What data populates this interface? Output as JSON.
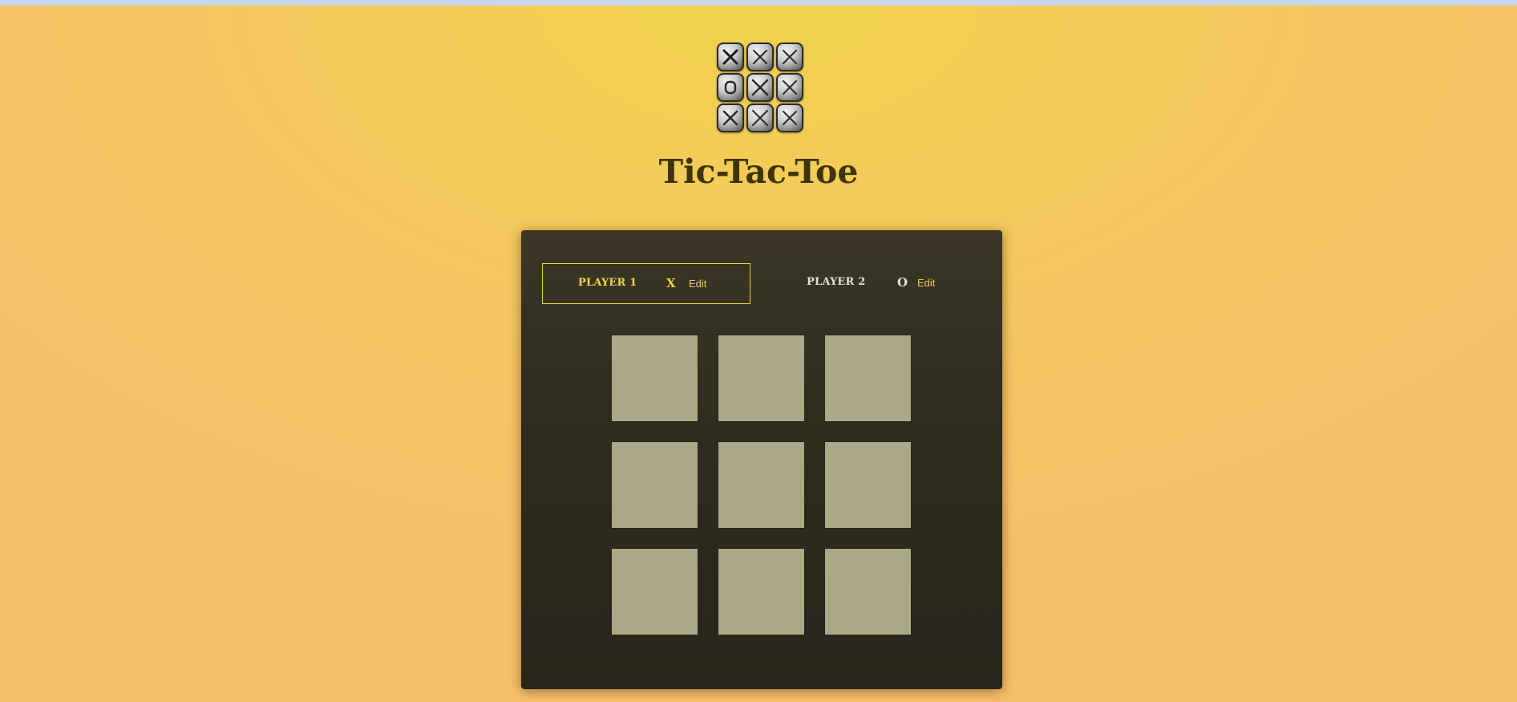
{
  "header": {
    "title": "Tic-Tac-Toe"
  },
  "logo": {
    "icon": "tic-tac-toe-logo-icon",
    "tiles": [
      "x",
      "x",
      "x",
      "o",
      "x",
      "x",
      "x",
      "x",
      "x"
    ]
  },
  "players": [
    {
      "name": "PLAYER 1",
      "symbol": "X",
      "edit_label": "Edit",
      "active": true
    },
    {
      "name": "PLAYER 2",
      "symbol": "O",
      "edit_label": "Edit",
      "active": false
    }
  ],
  "board": {
    "cells": [
      "",
      "",
      "",
      "",
      "",
      "",
      "",
      "",
      ""
    ]
  },
  "colors": {
    "accent": "#f1cf3a",
    "panel": "#2e2c1e",
    "cell": "#aba888",
    "title": "#3d3409"
  }
}
